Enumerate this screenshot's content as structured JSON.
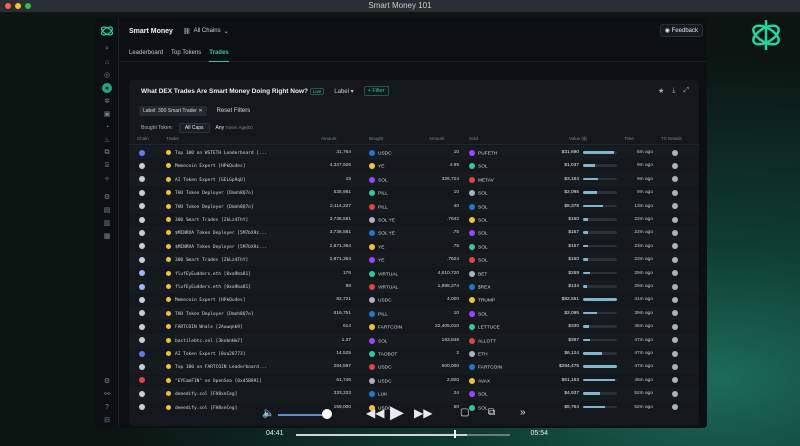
{
  "window": {
    "title": "Smart Money 101"
  },
  "colors": {
    "accent": "#33c79c",
    "brand": "#1fd6a4",
    "bar": "#7fb7cf",
    "bg": "#0d1013"
  },
  "header": {
    "title": "Smart Money",
    "chain_select": "All Chains",
    "feedback": "Feedback"
  },
  "tabs": [
    {
      "label": "Leaderboard",
      "active": false
    },
    {
      "label": "Top Tokens",
      "active": false
    },
    {
      "label": "Trades",
      "active": true
    }
  ],
  "panel": {
    "title": "What DEX Trades Are Smart Money Doing Right Now?",
    "live_badge": "Live",
    "label_dropdown": "Label",
    "filter_button": "+ Filter",
    "active_chip": "Label: 300 Smart Trader",
    "reset_filters": "Reset Filters",
    "bought_token_label": "Bought Token:",
    "bought_token_value": "All Caps",
    "token_age_value": "Any",
    "token_age_label": "Token Age(D)"
  },
  "table": {
    "headers": {
      "chain": "Chain",
      "trader": "Trader",
      "amount_bought": "Amount",
      "bought": "Bought",
      "amount_sold": "Amount",
      "sold": "Sold",
      "value": "Value ($)",
      "time": "Time",
      "details": "TX Details"
    },
    "rows": [
      {
        "chain": "eth",
        "trader": "Top 100 on WSTETH Leaderboard [...",
        "amt_b": "31,764",
        "bought": "USDC",
        "amt_s": "10",
        "sold": "PUFETH",
        "value": "$31,690",
        "pct": 0.9,
        "time": "6m ago"
      },
      {
        "chain": "sol",
        "trader": "Memecoin Expert [HPkQu4es]",
        "amt_b": "4,327,926",
        "bought": "YE",
        "amt_s": "4.95",
        "sold": "SOL",
        "value": "$1,037",
        "pct": 0.35,
        "time": "9m ago"
      },
      {
        "chain": "sol",
        "trader": "AI Token Expert [GELGp9qU]",
        "amt_b": "15",
        "bought": "SOL",
        "amt_s": "326,724",
        "sold": "METAV",
        "value": "$3,184",
        "pct": 0.45,
        "time": "9m ago"
      },
      {
        "chain": "sol",
        "trader": "THU Token Deployer [Dmnh8Q7o]",
        "amt_b": "535,981",
        "bought": "PILL",
        "amt_s": "10",
        "sold": "SOL",
        "value": "$2,095",
        "pct": 0.4,
        "time": "9m ago"
      },
      {
        "chain": "sol",
        "trader": "THU Token Deployer [Dmnh8Q7o]",
        "amt_b": "2,114,227",
        "bought": "PILL",
        "amt_s": "40",
        "sold": "SOL",
        "value": "$8,378",
        "pct": 0.6,
        "time": "13m ago"
      },
      {
        "chain": "sol",
        "trader": "300 Smart Trades [ZkLz4ThY]",
        "amt_b": "3,736,581",
        "bought": "SOL YE",
        "amt_s": ".7642",
        "sold": "SOL",
        "value": "$160",
        "pct": 0.15,
        "time": "22m ago"
      },
      {
        "chain": "sol",
        "trader": "$MINRVA Token Deployer [5M7bX9z...",
        "amt_b": "3,736,581",
        "bought": "SOL YE",
        "amt_s": ".75",
        "sold": "SOL",
        "value": "$157",
        "pct": 0.15,
        "time": "22m ago"
      },
      {
        "chain": "sol",
        "trader": "$MINRVA Token Deployer [5M7bX9z...",
        "amt_b": "2,871,364",
        "bought": "YE",
        "amt_s": ".75",
        "sold": "SOL",
        "value": "$157",
        "pct": 0.15,
        "time": "23m ago"
      },
      {
        "chain": "sol",
        "trader": "300 Smart Trades [ZkLz4ThY]",
        "amt_b": "2,871,364",
        "bought": "YE",
        "amt_s": ".7624",
        "sold": "SOL",
        "value": "$160",
        "pct": 0.15,
        "time": "23m ago"
      },
      {
        "chain": "base",
        "trader": "flufEyEudders.eth [0xa9ba81]",
        "amt_b": "176",
        "bought": "VIRTUAL",
        "amt_s": "4,910,720",
        "sold": "BET",
        "value": "$269",
        "pct": 0.2,
        "time": "29m ago"
      },
      {
        "chain": "base",
        "trader": "flufEyEudders.eth [0xa9ba81]",
        "amt_b": "88",
        "bought": "VIRTUAL",
        "amt_s": "1,898,274",
        "sold": "$REX",
        "value": "$134",
        "pct": 0.12,
        "time": "29m ago"
      },
      {
        "chain": "sol",
        "trader": "Memecoin Expert [HPkQu4es]",
        "amt_b": "82,721",
        "bought": "USDC",
        "amt_s": "4,000",
        "sold": "TRUMP",
        "value": "$82,551",
        "pct": 1.0,
        "time": "31m ago"
      },
      {
        "chain": "sol",
        "trader": "THU Token Deployer [Dmnh8Q7o]",
        "amt_b": "616,751",
        "bought": "PILL",
        "amt_s": "10",
        "sold": "SOL",
        "value": "$2,095",
        "pct": 0.4,
        "time": "39m ago"
      },
      {
        "chain": "sol",
        "trader": "FARTCOIN Whale [2Auwqnb9]",
        "amt_b": "614",
        "bought": "FARTCOIN",
        "amt_s": "22,405,010",
        "sold": "LETTUCE",
        "value": "$330",
        "pct": 0.18,
        "time": "46m ago"
      },
      {
        "chain": "sol",
        "trader": "bastilebtc.sol [3knbnHm7]",
        "amt_b": "1.37",
        "bought": "SOL",
        "amt_s": "193,849",
        "sold": "ALLOTT",
        "value": "$397",
        "pct": 0.2,
        "time": "47m ago"
      },
      {
        "chain": "eth",
        "trader": "AI Token Expert [0xa28773]",
        "amt_b": "14,525",
        "bought": "TAOBOT",
        "amt_s": "2",
        "sold": "ETH",
        "value": "$6,124",
        "pct": 0.55,
        "time": "47m ago"
      },
      {
        "chain": "sol",
        "trader": "Top 100 on FARTCOIN Leaderboard...",
        "amt_b": "284,597",
        "bought": "USDC",
        "amt_s": "500,000",
        "sold": "FARTCOIN",
        "value": "$284,475",
        "pct": 1.0,
        "time": "47m ago"
      },
      {
        "chain": "avax",
        "trader": "\"EYEamFIN\" on OpenSea [0xd5B891]",
        "amt_b": "61,746",
        "bought": "USDC",
        "amt_s": "2,800",
        "sold": "AVAX",
        "value": "$61,153",
        "pct": 0.95,
        "time": "48m ago"
      },
      {
        "chain": "sol",
        "trader": "deeedify.sol [FH8xnCeg]",
        "amt_b": "333,333",
        "bought": "LUK",
        "amt_s": "24",
        "sold": "SOL",
        "value": "$4,937",
        "pct": 0.5,
        "time": "52m ago"
      },
      {
        "chain": "sol",
        "trader": "deeedify.sol [FH8xnCeg]",
        "amt_b": "159,000",
        "bought": "USDC",
        "amt_s": "50",
        "sold": "SOL",
        "value": "$9,764",
        "pct": 0.65,
        "time": "52m ago"
      }
    ]
  },
  "media": {
    "current_time": "04:41",
    "end_time": "05:54",
    "progress": 0.8,
    "volume": 0.85
  }
}
